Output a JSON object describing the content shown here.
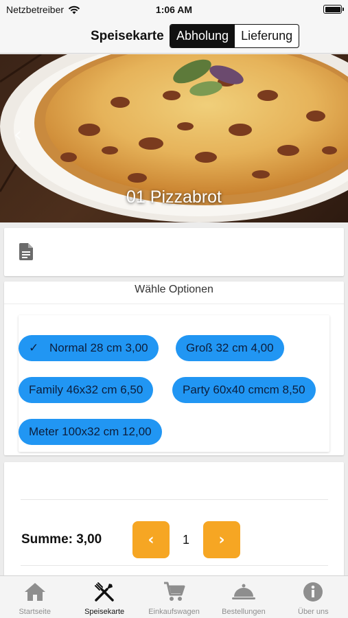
{
  "status_bar": {
    "carrier": "Netzbetreiber",
    "time": "1:06 AM"
  },
  "header": {
    "title": "Speisekarte",
    "segments": [
      {
        "label": "Abholung",
        "active": true
      },
      {
        "label": "Lieferung",
        "active": false
      }
    ]
  },
  "hero": {
    "title": "01 Pizzabrot"
  },
  "options": {
    "header": "Wähle Optionen",
    "chips": [
      {
        "label": "Normal 28 cm 3,00",
        "selected": true
      },
      {
        "label": "Groß 32 cm 4,00",
        "selected": false
      },
      {
        "label": "Family 46x32 cm 6,50",
        "selected": false
      },
      {
        "label": "Party 60x40 cmcm 8,50",
        "selected": false
      },
      {
        "label": "Meter 100x32 cm 12,00",
        "selected": false
      }
    ]
  },
  "summary": {
    "label": "Summe: 3,00",
    "quantity": "1",
    "decrement_icon": "chevron-left-icon",
    "increment_icon": "chevron-right-icon"
  },
  "tabbar": {
    "tabs": [
      {
        "label": "Startseite",
        "icon": "home-icon",
        "active": false
      },
      {
        "label": "Speisekarte",
        "icon": "fork-knife-icon",
        "active": true
      },
      {
        "label": "Einkaufswagen",
        "icon": "cart-icon",
        "active": false
      },
      {
        "label": "Bestellungen",
        "icon": "cloche-icon",
        "active": false
      },
      {
        "label": "Über uns",
        "icon": "info-icon",
        "active": false
      }
    ]
  },
  "colors": {
    "chip": "#2196f3",
    "stepper": "#f6a623",
    "active_segment": "#111111"
  }
}
